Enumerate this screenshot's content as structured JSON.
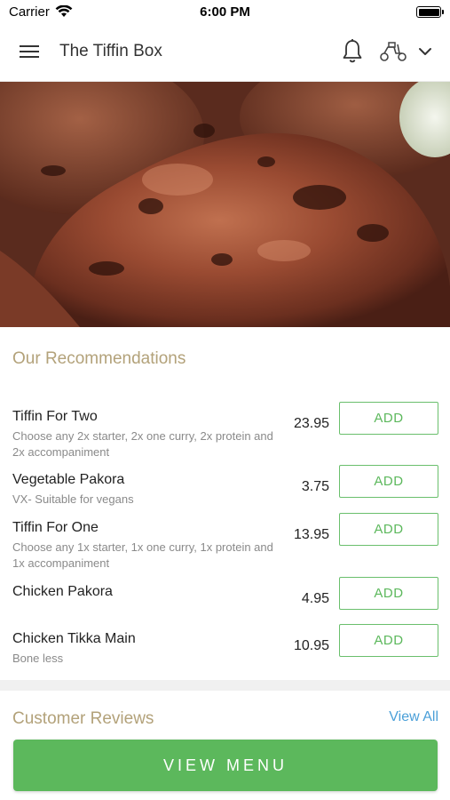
{
  "status_bar": {
    "carrier": "Carrier",
    "time": "6:00 PM"
  },
  "header": {
    "title": "The Tiffin Box"
  },
  "icons": {
    "menu": "hamburger-menu-icon",
    "notifications": "bell-icon",
    "delivery": "scooter-icon",
    "expand": "chevron-down-icon"
  },
  "recommendations": {
    "title": "Our Recommendations",
    "add_label": "ADD",
    "items": [
      {
        "name": "Tiffin For Two",
        "description": "Choose any 2x starter, 2x one curry, 2x protein and 2x accompaniment",
        "price": "23.95"
      },
      {
        "name": "Vegetable Pakora",
        "description": "VX- Suitable for vegans",
        "price": "3.75"
      },
      {
        "name": "Tiffin For One",
        "description": "Choose any 1x starter, 1x one curry, 1x protein and 1x accompaniment",
        "price": "13.95"
      },
      {
        "name": "Chicken Pakora",
        "description": "",
        "price": "4.95"
      },
      {
        "name": "Chicken Tikka Main",
        "description": "Bone less",
        "price": "10.95"
      }
    ]
  },
  "reviews": {
    "title": "Customer Reviews",
    "view_all": "View All"
  },
  "footer": {
    "view_menu": "VIEW MENU"
  },
  "colors": {
    "accent_green": "#5cb85c",
    "section_title": "#b3a27a",
    "link_blue": "#4a9fd8"
  }
}
